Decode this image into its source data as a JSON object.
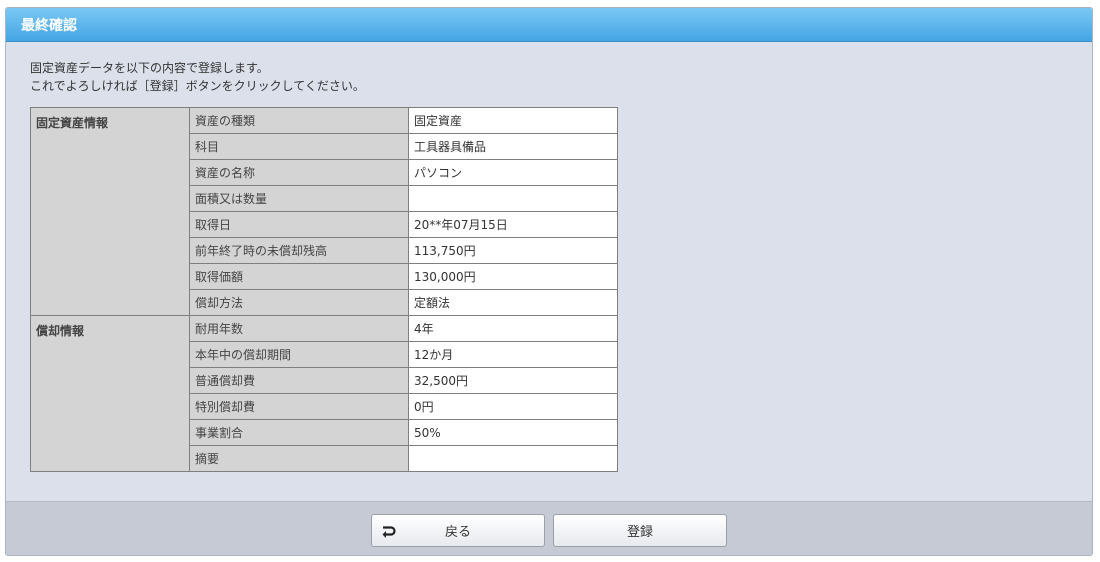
{
  "header": {
    "title": "最終確認"
  },
  "intro": {
    "line1": "固定資産データを以下の内容で登録します。",
    "line2": "これでよろしければ［登録］ボタンをクリックしてください。"
  },
  "sections": [
    {
      "name": "固定資産情報",
      "rows": [
        {
          "label": "資産の種類",
          "value": "固定資産"
        },
        {
          "label": "科目",
          "value": "工具器具備品"
        },
        {
          "label": "資産の名称",
          "value": "パソコン"
        },
        {
          "label": "面積又は数量",
          "value": ""
        },
        {
          "label": "取得日",
          "value": "20**年07月15日"
        },
        {
          "label": "前年終了時の未償却残高",
          "value": "113,750円"
        },
        {
          "label": "取得価額",
          "value": "130,000円"
        },
        {
          "label": "償却方法",
          "value": "定額法"
        }
      ]
    },
    {
      "name": "償却情報",
      "rows": [
        {
          "label": "耐用年数",
          "value": "4年"
        },
        {
          "label": "本年中の償却期間",
          "value": "12か月"
        },
        {
          "label": "普通償却費",
          "value": "32,500円"
        },
        {
          "label": "特別償却費",
          "value": "0円"
        },
        {
          "label": "事業割合",
          "value": "50%"
        },
        {
          "label": "摘要",
          "value": ""
        }
      ]
    }
  ],
  "footer": {
    "back_label": "戻る",
    "register_label": "登録"
  },
  "icons": {
    "back": "return-arrow-icon"
  },
  "colors": {
    "header_gradient_top": "#79c8f5",
    "header_gradient_bottom": "#45a5e3",
    "panel_bg": "#dbe0ea",
    "label_bg": "#d4d4d4"
  }
}
